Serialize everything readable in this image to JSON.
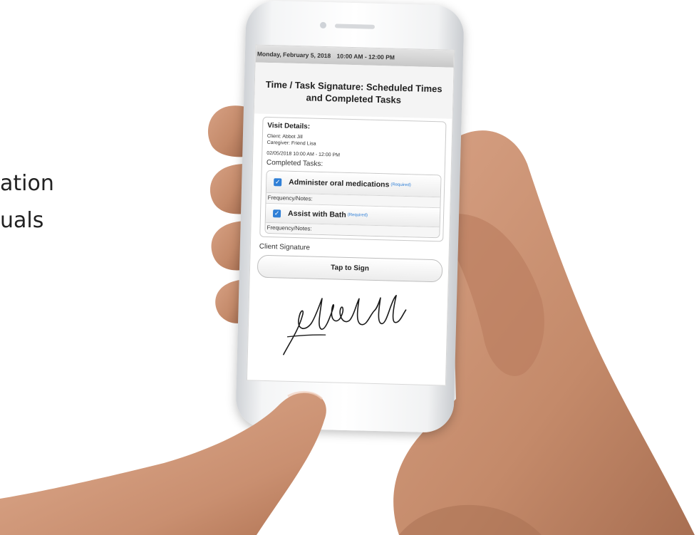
{
  "slide": {
    "line1": "ation",
    "line2": "uals"
  },
  "screen": {
    "date_bar": {
      "date": "Monday, February 5, 2018",
      "time_range": "10:00 AM  -  12:00 PM"
    },
    "title": "Time / Task Signature: Scheduled Times and Completed Tasks",
    "visit_details": {
      "heading": "Visit Details:",
      "client": "Client: Abbot Jill",
      "caregiver": "Caregiver: Friend Lisa",
      "datetime": "02/05/2018 10:00 AM - 12:00 PM",
      "completed_tasks_label": "Completed Tasks:"
    },
    "tasks": [
      {
        "label": "Administer oral medications",
        "required": "(Required)",
        "checked": true,
        "notes_label": "Frequency/Notes:"
      },
      {
        "label": "Assist with Bath",
        "required": "(Required)",
        "checked": true,
        "notes_label": "Frequency/Notes:"
      }
    ],
    "signature": {
      "label": "Client Signature",
      "button": "Tap to Sign"
    }
  },
  "colors": {
    "accent": "#2f7fd6",
    "skin": "#c98f70",
    "phone_frame": "#eef0f2"
  }
}
